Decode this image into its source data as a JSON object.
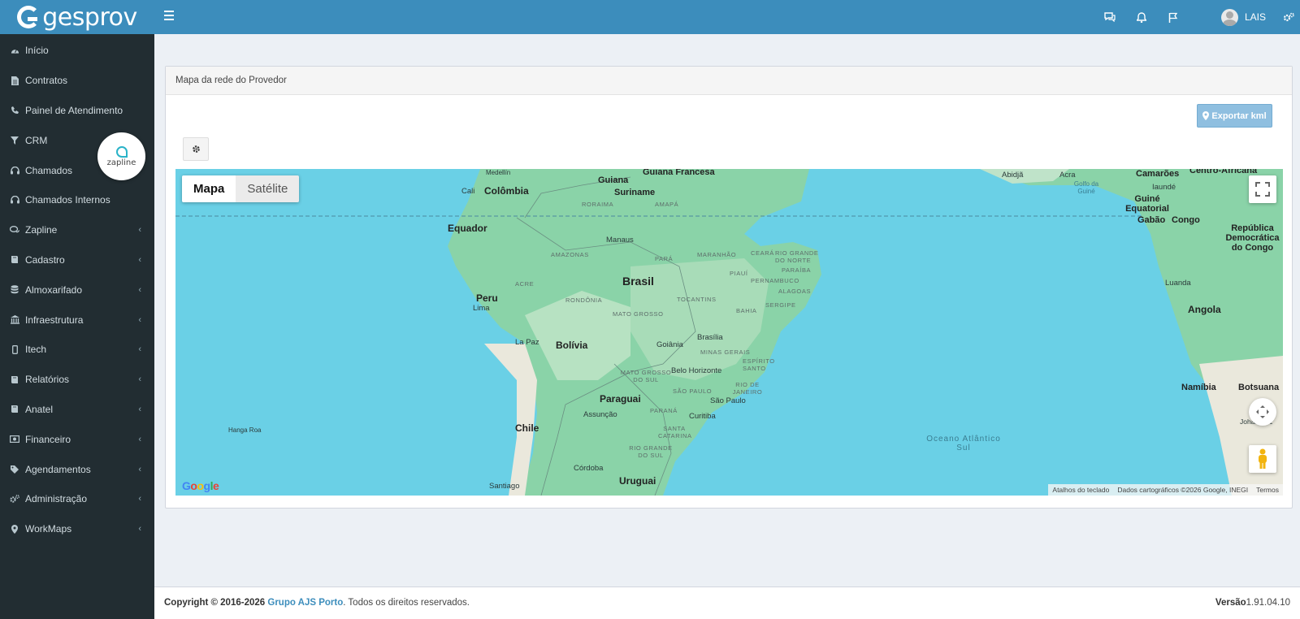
{
  "app": {
    "logo_text": "gesprov"
  },
  "header": {
    "user_name": "LAIS"
  },
  "sidebar": {
    "items": [
      {
        "label": "Início",
        "icon": "dashboard-icon",
        "submenu": false
      },
      {
        "label": "Contratos",
        "icon": "file-icon",
        "submenu": false
      },
      {
        "label": "Painel de Atendimento",
        "icon": "phone-icon",
        "submenu": false
      },
      {
        "label": "CRM",
        "icon": "filter-icon",
        "submenu": false
      },
      {
        "label": "Chamados",
        "icon": "headset-icon",
        "submenu": false
      },
      {
        "label": "Chamados Internos",
        "icon": "headset-icon",
        "submenu": false
      },
      {
        "label": "Zapline",
        "icon": "chat-icon",
        "submenu": true
      },
      {
        "label": "Cadastro",
        "icon": "book-icon",
        "submenu": true
      },
      {
        "label": "Almoxarifado",
        "icon": "database-icon",
        "submenu": true
      },
      {
        "label": "Infraestrutura",
        "icon": "bank-icon",
        "submenu": true
      },
      {
        "label": "Itech",
        "icon": "mobile-icon",
        "submenu": true
      },
      {
        "label": "Relatórios",
        "icon": "book-icon",
        "submenu": true
      },
      {
        "label": "Anatel",
        "icon": "book-icon",
        "submenu": true
      },
      {
        "label": "Financeiro",
        "icon": "money-icon",
        "submenu": true
      },
      {
        "label": "Agendamentos",
        "icon": "tag-icon",
        "submenu": true
      },
      {
        "label": "Administração",
        "icon": "cogs-icon",
        "submenu": true
      },
      {
        "label": "WorkMaps",
        "icon": "map-marker-icon",
        "submenu": true
      }
    ]
  },
  "zapline_badge": {
    "text": "zapline"
  },
  "panel": {
    "title": "Mapa da rede do Provedor",
    "export_label": "Exportar kml"
  },
  "map": {
    "type_buttons": [
      "Mapa",
      "Satélite"
    ],
    "selected_type": "Mapa",
    "google_logo": "Google",
    "attribution": {
      "shortcuts": "Atalhos do teclado",
      "data": "Dados cartográficos ©2026 Google, INEGI",
      "terms": "Termos"
    },
    "labels": {
      "countries": [
        "Guiana",
        "Guiana Francesa",
        "Suriname",
        "Colômbia",
        "Equador",
        "Brasil",
        "Peru",
        "Bolívia",
        "Paraguai",
        "Chile",
        "Uruguai",
        "Camarões",
        "Centro-Africana",
        "Guiné Equatorial",
        "Gabão",
        "Congo",
        "República Democrática do Congo",
        "Angola",
        "Namíbia",
        "Botsuana"
      ],
      "states": [
        "RORAIMA",
        "AMAPÁ",
        "AMAZONAS",
        "PARÁ",
        "MARANHÃO",
        "CEARÁ",
        "RIO GRANDE DO NORTE",
        "PARAÍBA",
        "PIAUÍ",
        "PERNAMBUCO",
        "ACRE",
        "ALAGOAS",
        "RONDÔNIA",
        "TOCANTINS",
        "SERGIPE",
        "MATO GROSSO",
        "BAHIA",
        "MINAS GERAIS",
        "ESPÍRITO SANTO",
        "MATO GROSSO DO SUL",
        "RIO DE JANEIRO",
        "SÃO PAULO",
        "PARANÁ",
        "SANTA CATARINA",
        "RIO GRANDE DO SUL"
      ],
      "cities": [
        "Medellín",
        "Cali",
        "Manaus",
        "Lima",
        "La Paz",
        "Brasília",
        "Goiânia",
        "Belo Horizonte",
        "São Paulo",
        "Curitiba",
        "Assunção",
        "Córdoba",
        "Santiago",
        "Hanga Roa",
        "Abidjã",
        "Acra",
        "Iaundé",
        "Luanda",
        "Johannesburg"
      ],
      "water": [
        "Oceano Atlântico Sul",
        "Golfo da Guiné"
      ]
    }
  },
  "footer": {
    "copyright_prefix": "Copyright © 2016-2026",
    "company": "Grupo AJS Porto",
    "suffix": ". Todos os direitos reservados.",
    "version_label": "Versão",
    "version_value": "1.91.04.10"
  }
}
